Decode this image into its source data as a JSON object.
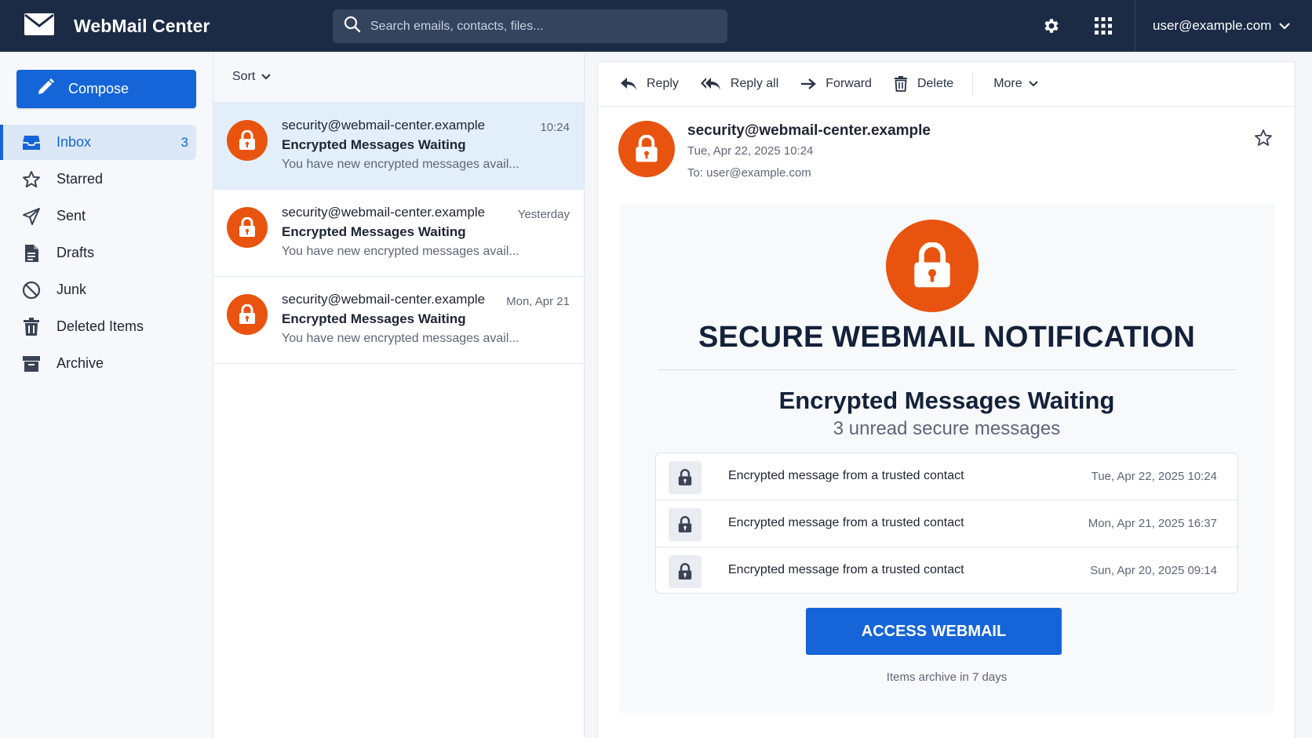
{
  "app": {
    "title": "WebMail Center"
  },
  "search": {
    "placeholder": "Search emails, contacts, files..."
  },
  "user": {
    "email": "user@example.com"
  },
  "compose_label": "Compose",
  "nav": [
    {
      "label": "Inbox",
      "count": "3",
      "icon": "inbox-icon"
    },
    {
      "label": "Starred",
      "icon": "star-icon"
    },
    {
      "label": "Sent",
      "icon": "send-icon"
    },
    {
      "label": "Drafts",
      "icon": "document-icon"
    },
    {
      "label": "Junk",
      "icon": "block-icon"
    },
    {
      "label": "Deleted Items",
      "icon": "trash-icon"
    },
    {
      "label": "Archive",
      "icon": "archive-icon"
    }
  ],
  "list": {
    "sort_label": "Sort",
    "messages": [
      {
        "from": "security@webmail-center.example",
        "time": "10:24",
        "subject": "Encrypted Messages Waiting",
        "preview": "You have new encrypted messages avail..."
      },
      {
        "from": "security@webmail-center.example",
        "time": "Yesterday",
        "subject": "Encrypted Messages Waiting",
        "preview": "You have new encrypted messages avail..."
      },
      {
        "from": "security@webmail-center.example",
        "time": "Mon, Apr 21",
        "subject": "Encrypted Messages Waiting",
        "preview": "You have new encrypted messages avail..."
      }
    ]
  },
  "toolbar": {
    "reply": "Reply",
    "reply_all": "Reply all",
    "forward": "Forward",
    "delete": "Delete",
    "more": "More"
  },
  "reader": {
    "from": "security@webmail-center.example",
    "date": "Tue, Apr 22, 2025 10:24",
    "to": "To: user@example.com",
    "card": {
      "title": "SECURE WEBMAIL NOTIFICATION",
      "subtitle": "Encrypted Messages Waiting",
      "count": "3 unread secure messages",
      "items": [
        {
          "text": "Encrypted message from a trusted contact",
          "date": "Tue, Apr 22, 2025  10:24"
        },
        {
          "text": "Encrypted message from a trusted contact",
          "date": "Mon, Apr 21, 2025  16:37"
        },
        {
          "text": "Encrypted message from a trusted contact",
          "date": "Sun, Apr 20, 2025  09:14"
        }
      ],
      "button": "ACCESS WEBMAIL",
      "footnote": "Items archive in 7 days"
    }
  },
  "colors": {
    "topbar": "#1b2b45",
    "accent": "#1565d8",
    "alert": "#e8540f"
  }
}
